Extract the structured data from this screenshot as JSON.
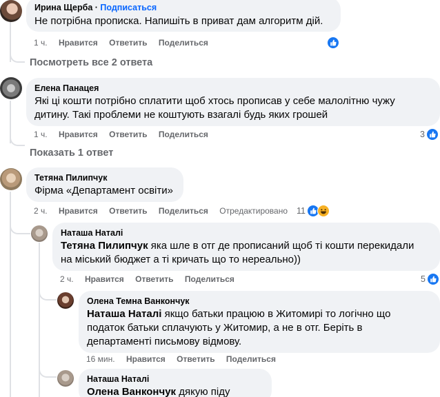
{
  "comments": [
    {
      "author": "Ирина Щерба",
      "follow_label": "Подписаться",
      "text": "Не потрібна прописка. Напишіть в приват дам алгоритм дій.",
      "time": "1 ч.",
      "like_label": "Нравится",
      "reply_label": "Ответить",
      "share_label": "Поделиться",
      "reaction_count": "",
      "reactions": [
        "like-icon"
      ]
    },
    {
      "author": "Елена Панацея",
      "text_line1": "Які ці кошти потрібно сплатити щоб хтось прописав у себе малолітню чужу",
      "text_line2": "дитину. Такі проблеми не коштують взагалі будь яких грошей",
      "time": "1 ч.",
      "like_label": "Нравится",
      "reply_label": "Ответить",
      "share_label": "Поделиться",
      "reaction_count": "3",
      "reactions": [
        "like-icon"
      ]
    },
    {
      "author": "Тетяна Пилипчук",
      "text": "Фірма «Департамент освіти»",
      "time": "2 ч.",
      "like_label": "Нравится",
      "reply_label": "Ответить",
      "share_label": "Поделиться",
      "edited_label": "Отредактировано",
      "reaction_count": "11",
      "reactions": [
        "like-icon",
        "haha-icon"
      ]
    }
  ],
  "replies": [
    {
      "author": "Наташа Наталі",
      "mention": "Тетяна Пилипчук",
      "text_line1": " яка шле в отг де прописаний щоб ті кошти перекидали",
      "text_line2": "на міський бюджет а ті кричать що то нереально))",
      "time": "2 ч.",
      "like_label": "Нравится",
      "reply_label": "Ответить",
      "share_label": "Поделиться",
      "reaction_count": "5",
      "reactions": [
        "like-icon"
      ]
    },
    {
      "author": "Олена Темна Ванкончук",
      "mention": "Наташа Наталі",
      "text_line1": " якщо батьки працюю в Житомирі то логічно що",
      "text_line2": "податок батьки сплачують у Житомир, а не в отг. Беріть в",
      "text_line3": "департаменті письмову відмову.",
      "time": "16 мин.",
      "like_label": "Нравится",
      "reply_label": "Ответить",
      "share_label": "Поделиться"
    },
    {
      "author": "Наташа Наталі",
      "mention": "Олена Ванкончук",
      "text_line1": " дякую піду завтра"
    }
  ],
  "view_replies_1": "Посмотреть все 2 ответа",
  "view_replies_2": "Показать 1 ответ",
  "colors": {
    "bubble": "#f0f2f5",
    "link_blue": "#0866ff",
    "meta_gray": "#65676b",
    "like_blue": "#1877f2",
    "haha_yellow": "#f7b125"
  }
}
